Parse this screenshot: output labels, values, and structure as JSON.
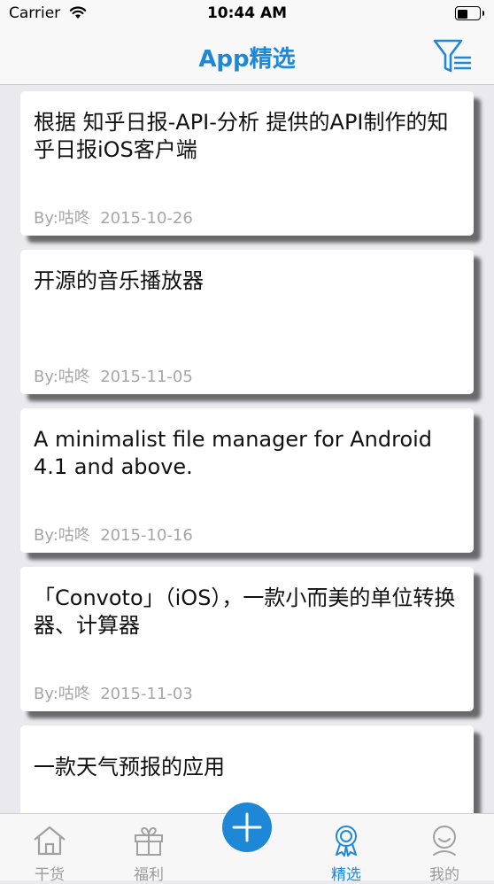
{
  "status_bar": {
    "carrier": "Carrier",
    "time": "10:44 AM"
  },
  "nav": {
    "title": "App精选",
    "filter_icon": "filter-list-icon"
  },
  "colors": {
    "accent": "#1e88d6",
    "background": "#e9e9ee",
    "meta_text": "#a6a6a6"
  },
  "items": [
    {
      "title": "根据 知乎日报-API-分析 提供的API制作的知乎日报iOS客户端",
      "meta": "By:咕咚  2015-10-26"
    },
    {
      "title": "开源的音乐播放器",
      "meta": "By:咕咚  2015-11-05"
    },
    {
      "title": "A minimalist file manager for Android 4.1 and above.",
      "meta": "By:咕咚  2015-10-16"
    },
    {
      "title": "「Convoto」（iOS），一款小而美的单位转换器、计算器",
      "meta": "By:咕咚  2015-11-03"
    },
    {
      "title": "一款天气预报的应用",
      "meta": ""
    }
  ],
  "tabs": [
    {
      "label": "干货",
      "icon": "home-icon",
      "active": false
    },
    {
      "label": "福利",
      "icon": "gift-icon",
      "active": false
    },
    {
      "label": "",
      "icon": "plus-icon",
      "active": false
    },
    {
      "label": "精选",
      "icon": "award-icon",
      "active": true
    },
    {
      "label": "我的",
      "icon": "profile-icon",
      "active": false
    }
  ]
}
